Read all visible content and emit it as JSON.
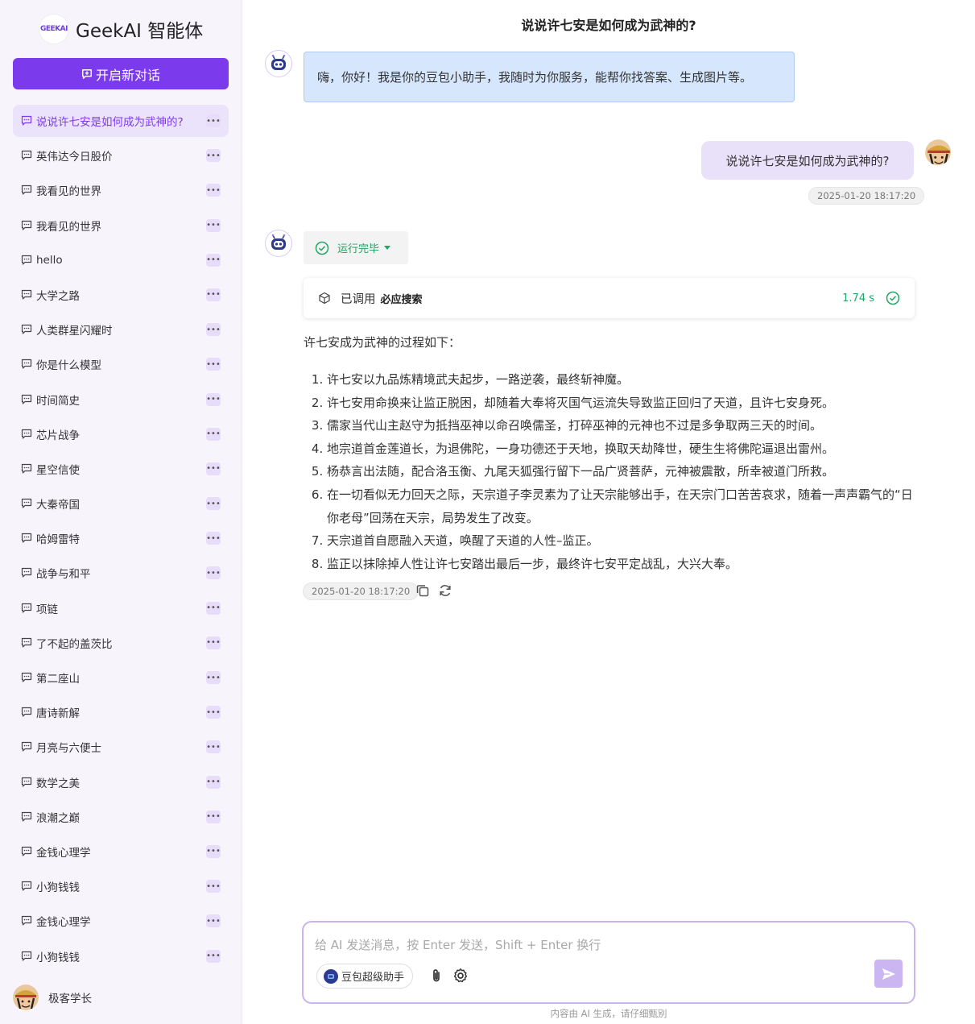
{
  "brand": {
    "logo_text": "GEEKAI",
    "name": "GeekAI 智能体"
  },
  "sidebar": {
    "new_chat_label": "开启新对话",
    "conversations": [
      "说说许七安是如何成为武神的?",
      "英伟达今日股价",
      "我看见的世界",
      "我看见的世界",
      "hello",
      "大学之路",
      "人类群星闪耀时",
      "你是什么模型",
      "时间简史",
      "芯片战争",
      "星空信使",
      "大秦帝国",
      "哈姆雷特",
      "战争与和平",
      "项链",
      "了不起的盖茨比",
      "第二座山",
      "唐诗新解",
      "月亮与六便士",
      "数学之美",
      "浪潮之巅",
      "金钱心理学",
      "小狗钱钱",
      "金钱心理学",
      "小狗钱钱"
    ],
    "more_label": "•••",
    "user_name": "极客学长"
  },
  "chat": {
    "title": "说说许七安是如何成为武神的?",
    "greeting": "嗨，你好！我是你的豆包小助手，我随时为你服务，能帮你找答案、生成图片等。",
    "user_message": "说说许七安是如何成为武神的?",
    "user_time": "2025-01-20 18:17:20",
    "status": "运行完毕",
    "tool_call": {
      "prefix": "已调用",
      "tool": "必应搜索",
      "duration": "1.74 s"
    },
    "answer_intro": "许七安成为武神的过程如下：",
    "answer_items": [
      "许七安以九品炼精境武夫起步，一路逆袭，最终斩神魔。",
      "许七安用命换来让监正脱困，却随着大奉将灭国气运流失导致监正回归了天道，且许七安身死。",
      "儒家当代山主赵守为抵挡巫神以命召唤儒圣，打碎巫神的元神也不过是多争取两三天的时间。",
      "地宗道首金莲道长，为退佛陀，一身功德还于天地，换取天劫降世，硬生生将佛陀逼退出雷州。",
      "杨恭言出法随，配合洛玉衡、九尾天狐强行留下一品广贤菩萨，元神被震散，所幸被道门所救。",
      "在一切看似无力回天之际，天宗道子李灵素为了让天宗能够出手，在天宗门口苦苦哀求，随着一声声霸气的“日你老母”回荡在天宗，局势发生了改变。",
      "天宗道首自愿融入天道，唤醒了天道的人性–监正。",
      "监正以抹除掉人性让许七安踏出最后一步，最终许七安平定战乱，大兴大奉。"
    ],
    "answer_time": "2025-01-20 18:17:20"
  },
  "composer": {
    "placeholder": "给 AI 发送消息，按 Enter 发送，Shift + Enter 换行",
    "model_label": "豆包超级助手",
    "disclaimer": "内容由 AI 生成，请仔细甄别"
  },
  "colors": {
    "accent": "#7c3aed",
    "success": "#21a564",
    "greet_bg": "#d6e6fd",
    "user_bubble": "#e9e1f9"
  }
}
